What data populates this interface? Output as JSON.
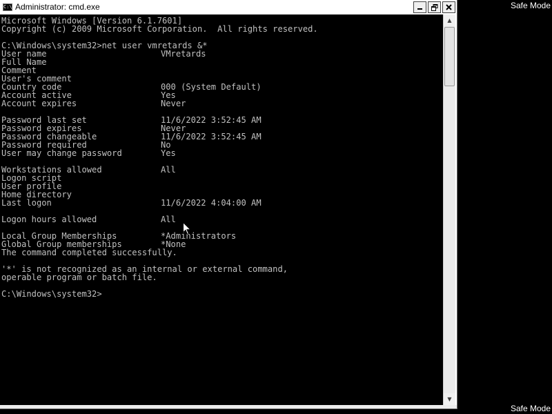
{
  "desktop": {
    "safe_mode_top": "Safe Mode",
    "safe_mode_bottom": "Safe Mode"
  },
  "window": {
    "title": "Administrator: cmd.exe",
    "icon_text": "C:\\",
    "buttons": {
      "minimize_icon": "minimize-icon",
      "maximize_icon": "restore-icon",
      "close_icon": "close-icon"
    }
  },
  "console": {
    "lines": [
      {
        "label": "Microsoft Windows [Version 6.1.7601]",
        "value": ""
      },
      {
        "label": "Copyright (c) 2009 Microsoft Corporation.  All rights reserved.",
        "value": ""
      },
      {
        "label": "",
        "value": ""
      },
      {
        "label": "C:\\Windows\\system32>net user vmretards &*",
        "value": ""
      },
      {
        "label": "User name",
        "value": "VMretards"
      },
      {
        "label": "Full Name",
        "value": ""
      },
      {
        "label": "Comment",
        "value": ""
      },
      {
        "label": "User's comment",
        "value": ""
      },
      {
        "label": "Country code",
        "value": "000 (System Default)"
      },
      {
        "label": "Account active",
        "value": "Yes"
      },
      {
        "label": "Account expires",
        "value": "Never"
      },
      {
        "label": "",
        "value": ""
      },
      {
        "label": "Password last set",
        "value": "11/6/2022 3:52:45 AM"
      },
      {
        "label": "Password expires",
        "value": "Never"
      },
      {
        "label": "Password changeable",
        "value": "11/6/2022 3:52:45 AM"
      },
      {
        "label": "Password required",
        "value": "No"
      },
      {
        "label": "User may change password",
        "value": "Yes"
      },
      {
        "label": "",
        "value": ""
      },
      {
        "label": "Workstations allowed",
        "value": "All"
      },
      {
        "label": "Logon script",
        "value": ""
      },
      {
        "label": "User profile",
        "value": ""
      },
      {
        "label": "Home directory",
        "value": ""
      },
      {
        "label": "Last logon",
        "value": "11/6/2022 4:04:00 AM"
      },
      {
        "label": "",
        "value": ""
      },
      {
        "label": "Logon hours allowed",
        "value": "All"
      },
      {
        "label": "",
        "value": ""
      },
      {
        "label": "Local Group Memberships",
        "value": "*Administrators"
      },
      {
        "label": "Global Group memberships",
        "value": "*None"
      },
      {
        "label": "The command completed successfully.",
        "value": ""
      },
      {
        "label": "",
        "value": ""
      },
      {
        "label": "'*' is not recognized as an internal or external command,",
        "value": ""
      },
      {
        "label": "operable program or batch file.",
        "value": ""
      },
      {
        "label": "",
        "value": ""
      },
      {
        "label": "C:\\Windows\\system32>",
        "value": ""
      }
    ]
  },
  "colors": {
    "console_bg": "#000000",
    "console_text": "#c0c0c0",
    "titlebar_bg": "#ffffff"
  }
}
